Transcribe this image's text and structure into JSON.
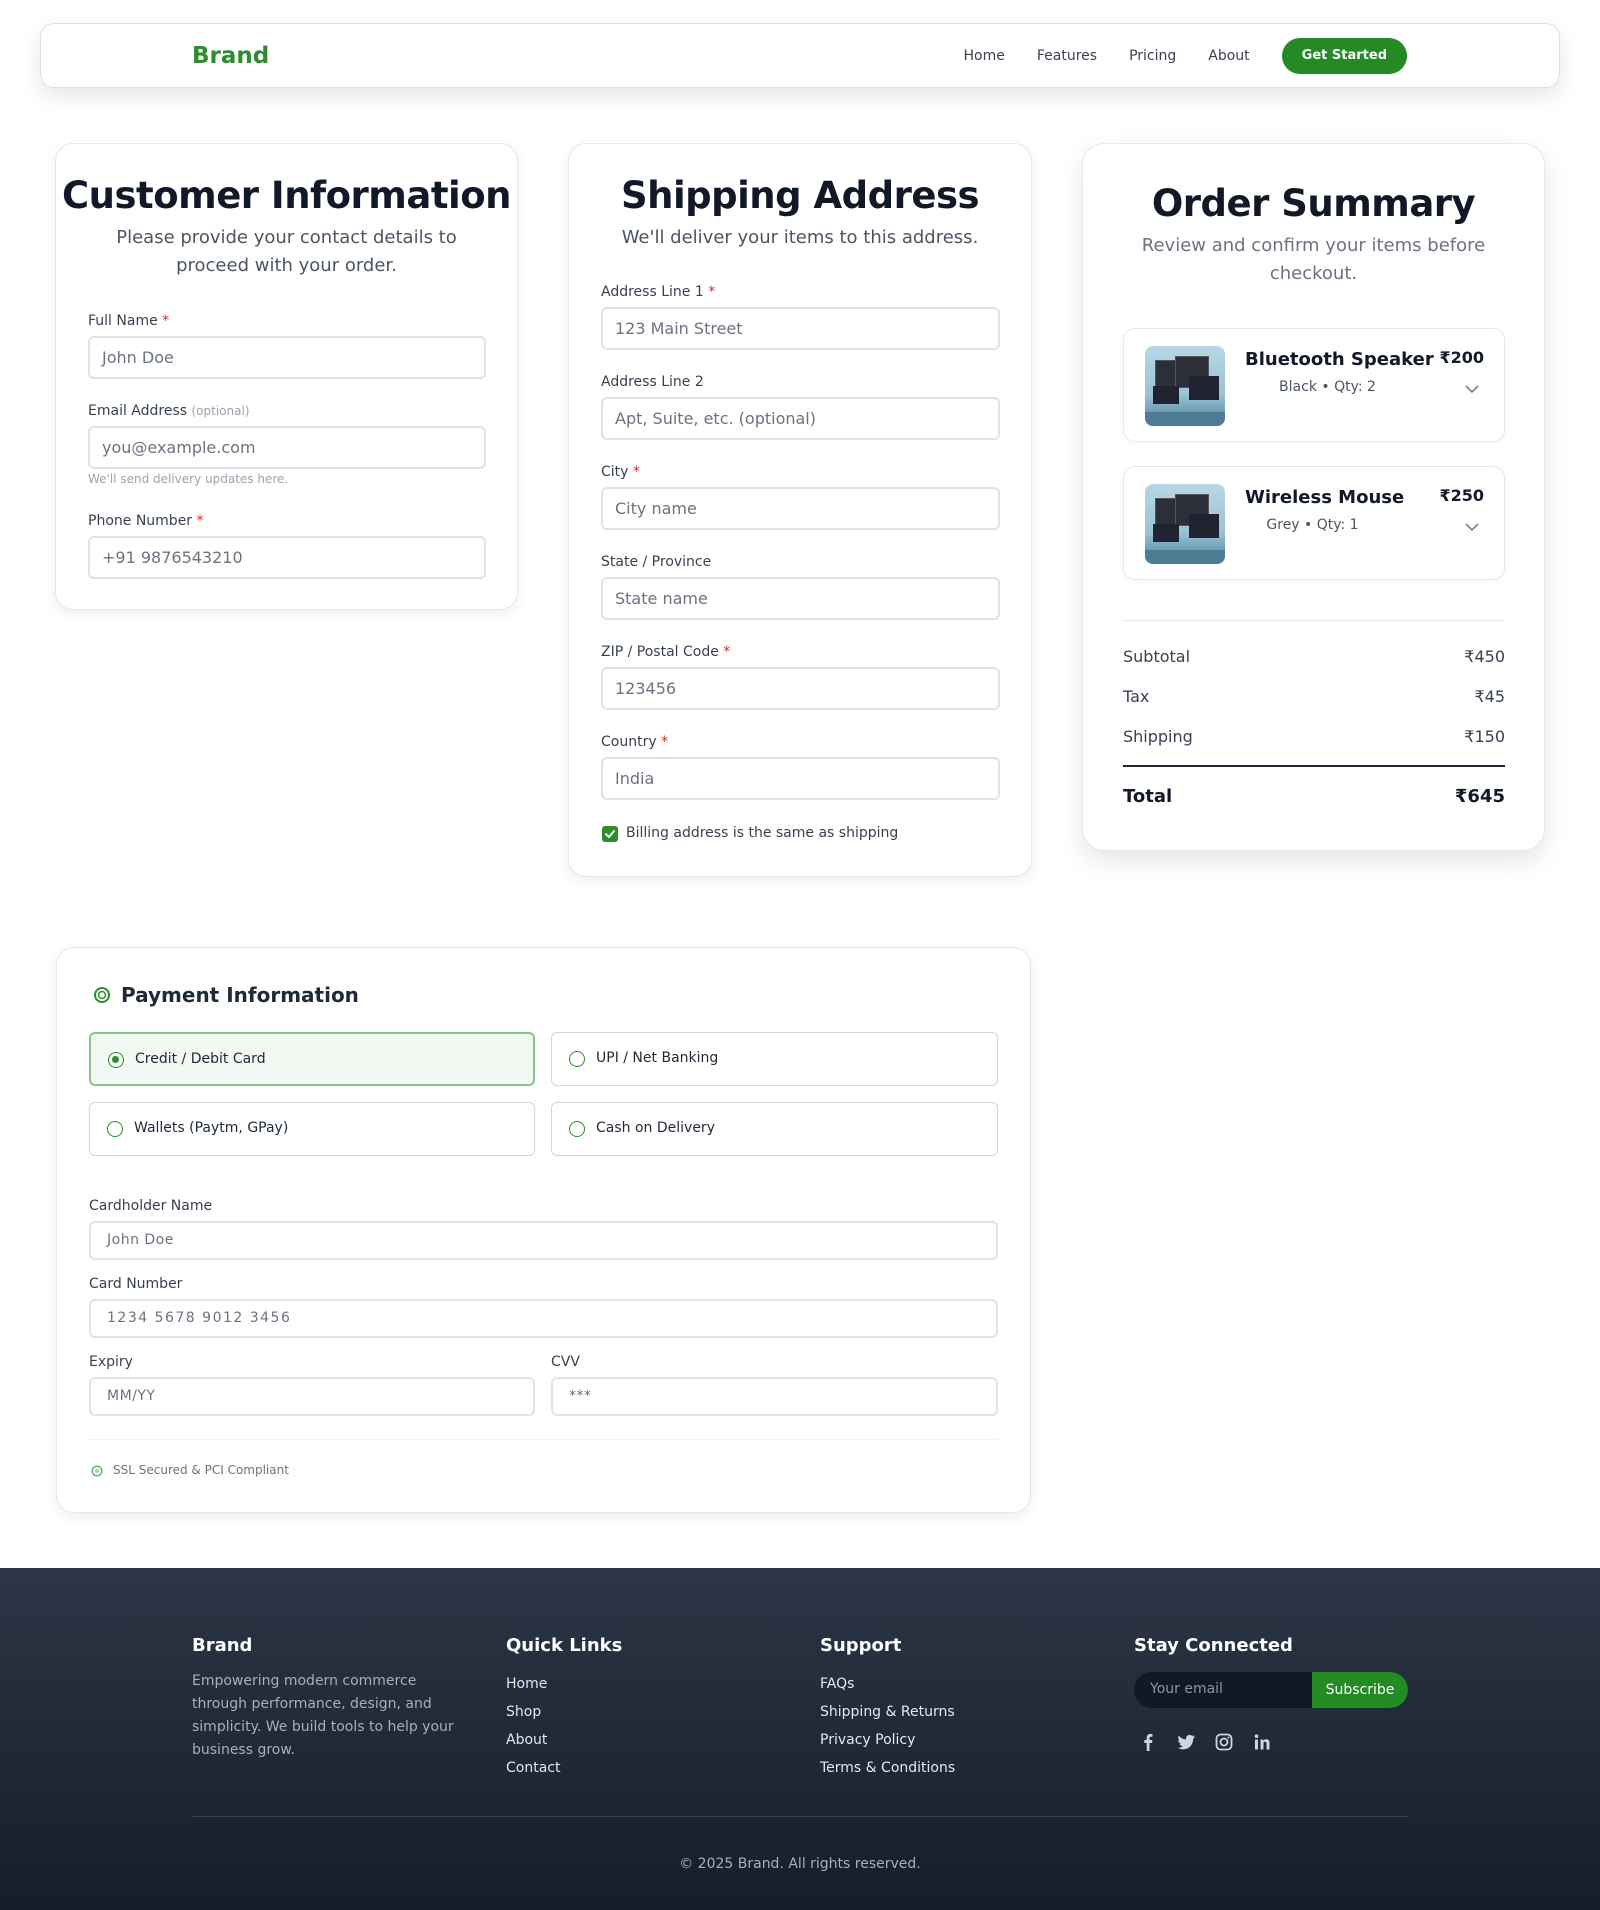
{
  "header": {
    "brand": "Brand",
    "nav": [
      "Home",
      "Features",
      "Pricing",
      "About"
    ],
    "cta": "Get Started"
  },
  "customer": {
    "title": "Customer Information",
    "subtitle": "Please provide your contact details to proceed with your order.",
    "full_name_label": "Full Name",
    "full_name_placeholder": "John Doe",
    "email_label": "Email Address",
    "email_optional": "(optional)",
    "email_placeholder": "you@example.com",
    "email_hint": "We'll send delivery updates here.",
    "phone_label": "Phone Number",
    "phone_placeholder": "+91 9876543210",
    "required_mark": "*"
  },
  "shipping": {
    "title": "Shipping Address",
    "subtitle": "We'll deliver your items to this address.",
    "addr1_label": "Address Line 1",
    "addr1_placeholder": "123 Main Street",
    "addr2_label": "Address Line 2",
    "addr2_placeholder": "Apt, Suite, etc. (optional)",
    "city_label": "City",
    "city_placeholder": "City name",
    "state_label": "State / Province",
    "state_placeholder": "State name",
    "zip_label": "ZIP / Postal Code",
    "zip_placeholder": "123456",
    "country_label": "Country",
    "country_placeholder": "India",
    "billing_same_label": "Billing address is the same as shipping",
    "billing_same_checked": true
  },
  "order": {
    "title": "Order Summary",
    "subtitle": "Review and confirm your items before checkout.",
    "items": [
      {
        "name": "Bluetooth Speaker",
        "meta": "Black • Qty: 2",
        "price": "₹200"
      },
      {
        "name": "Wireless Mouse",
        "meta": "Grey • Qty: 1",
        "price": "₹250"
      }
    ],
    "subtotal_label": "Subtotal",
    "subtotal": "₹450",
    "tax_label": "Tax",
    "tax": "₹45",
    "shipping_label": "Shipping",
    "shipping": "₹150",
    "total_label": "Total",
    "total": "₹645"
  },
  "payment": {
    "title": "Payment Information",
    "options": [
      "Credit / Debit Card",
      "UPI / Net Banking",
      "Wallets (Paytm, GPay)",
      "Cash on Delivery"
    ],
    "selected": "Credit / Debit Card",
    "cardholder_label": "Cardholder Name",
    "cardholder_placeholder": "John Doe",
    "card_number_label": "Card Number",
    "card_number_placeholder": "1234 5678 9012 3456",
    "expiry_label": "Expiry",
    "expiry_placeholder": "MM/YY",
    "cvv_label": "CVV",
    "cvv_placeholder": "***",
    "security_note": "SSL Secured & PCI Compliant"
  },
  "footer": {
    "brand": "Brand",
    "about": "Empowering modern commerce through performance, design, and simplicity. We build tools to help your business grow.",
    "quick_links_title": "Quick Links",
    "quick_links": [
      "Home",
      "Shop",
      "About",
      "Contact"
    ],
    "support_title": "Support",
    "support_links": [
      "FAQs",
      "Shipping & Returns",
      "Privacy Policy",
      "Terms & Conditions"
    ],
    "connect_title": "Stay Connected",
    "email_placeholder": "Your email",
    "subscribe": "Subscribe",
    "socials": [
      "facebook-icon",
      "twitter-icon",
      "instagram-icon",
      "linkedin-icon"
    ],
    "copyright": "© 2025 Brand. All rights reserved."
  },
  "colors": {
    "brand_green": "#248a24",
    "accent_green": "#2e8b2e",
    "footer_bg": "#1f2636"
  }
}
